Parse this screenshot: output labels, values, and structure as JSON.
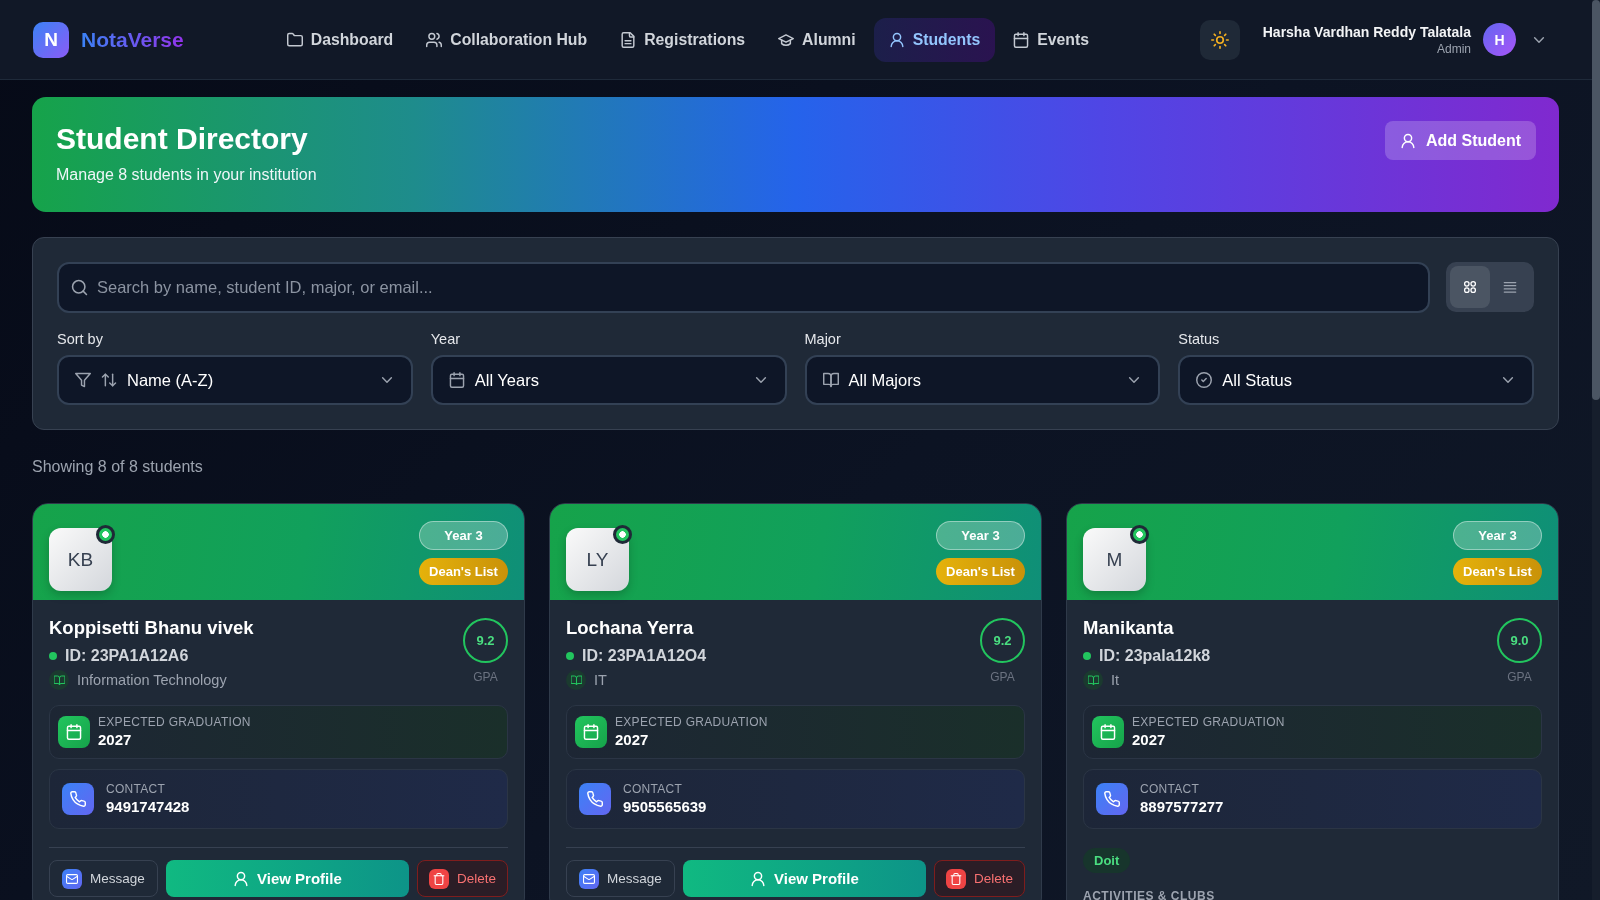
{
  "app": {
    "logo_letter": "N",
    "name": "NotaVerse"
  },
  "nav": [
    {
      "label": "Dashboard",
      "selected": false
    },
    {
      "label": "Collaboration Hub",
      "selected": false
    },
    {
      "label": "Registrations",
      "selected": false
    },
    {
      "label": "Alumni",
      "selected": false
    },
    {
      "label": "Students",
      "selected": true
    },
    {
      "label": "Events",
      "selected": false
    }
  ],
  "user": {
    "name": "Harsha Vardhan Reddy Talatala",
    "role": "Admin",
    "initial": "H"
  },
  "header": {
    "title": "Student Directory",
    "subtitle": "Manage 8 students in your institution",
    "button": "Add Student"
  },
  "search": {
    "placeholder": "Search by name, student ID, major, or email..."
  },
  "view_toggle": [
    {
      "selected": true
    },
    {
      "selected": false
    }
  ],
  "filters": [
    {
      "label": "Sort by",
      "value": "Name (A-Z)"
    },
    {
      "label": "Year",
      "value": "All Years"
    },
    {
      "label": "Major",
      "value": "All Majors"
    },
    {
      "label": "Status",
      "value": "All Status"
    }
  ],
  "results_count": "Showing 8 of 8 students",
  "students": [
    {
      "initials": "KB",
      "online": true,
      "year": "Year 3",
      "badge": "Dean's List",
      "name": "Koppisetti Bhanu vivek",
      "id": "ID: 23PA1A12A6",
      "major": "Information Technology",
      "gpa": "9.2",
      "gpa_label": "GPA",
      "graduation_label": "EXPECTED GRADUATION",
      "graduation": "2027",
      "contact_label": "CONTACT",
      "contact": "9491747428",
      "actions": [
        {
          "kind": "message",
          "label": "Message"
        },
        {
          "kind": "profile",
          "label": "View Profile"
        },
        {
          "kind": "delete",
          "label": "Delete"
        }
      ]
    },
    {
      "initials": "LY",
      "online": true,
      "year": "Year 3",
      "badge": "Dean's List",
      "name": "Lochana Yerra",
      "id": "ID: 23PA1A12O4",
      "major": "IT",
      "gpa": "9.2",
      "gpa_label": "GPA",
      "graduation_label": "EXPECTED GRADUATION",
      "graduation": "2027",
      "contact_label": "CONTACT",
      "contact": "9505565639",
      "actions": [
        {
          "kind": "message",
          "label": "Message"
        },
        {
          "kind": "profile",
          "label": "View Profile"
        },
        {
          "kind": "delete",
          "label": "Delete"
        }
      ]
    },
    {
      "initials": "M",
      "online": true,
      "year": "Year 3",
      "badge": "Dean's List",
      "name": "Manikanta",
      "id": "ID: 23pala12k8",
      "major": "It",
      "gpa": "9.0",
      "gpa_label": "GPA",
      "graduation_label": "EXPECTED GRADUATION",
      "graduation": "2027",
      "contact_label": "CONTACT",
      "contact": "8897577277",
      "tags": [
        "Doit"
      ],
      "activities_label": "ACTIVITIES & CLUBS"
    }
  ]
}
